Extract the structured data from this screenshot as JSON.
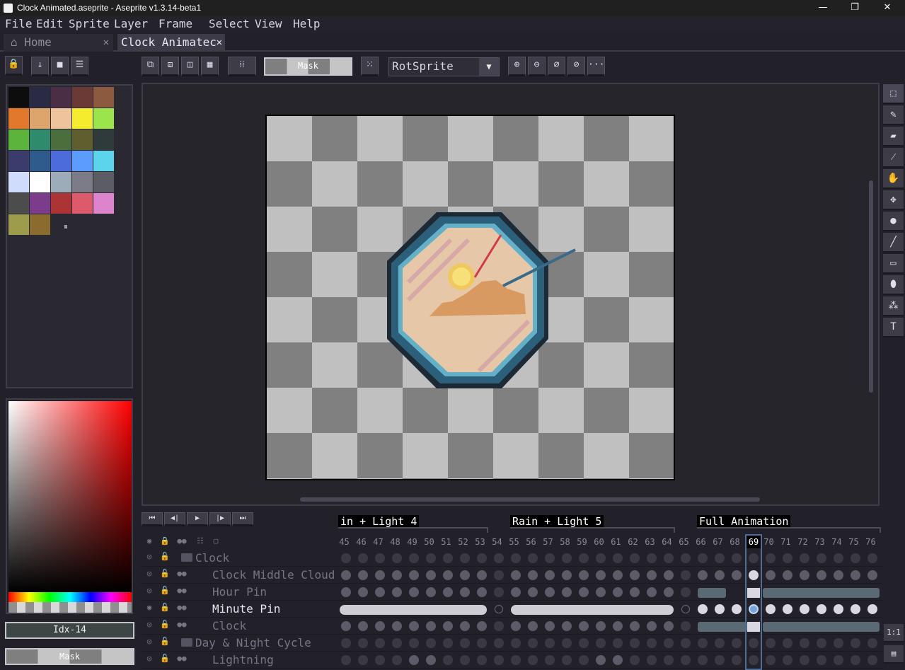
{
  "window": {
    "title": "Clock Animated.aseprite - Aseprite v1.3.14-beta1",
    "minimize": "—",
    "maximize": "❐",
    "close": "✕"
  },
  "menu": [
    {
      "label": "File"
    },
    {
      "label": "Edit"
    },
    {
      "label": "Sprite"
    },
    {
      "label": "Layer"
    },
    {
      "label": "Frame"
    },
    {
      "label": "Select"
    },
    {
      "label": "View"
    },
    {
      "label": "Help"
    }
  ],
  "tabs": {
    "home": "Home",
    "active": "Clock Animatec",
    "close": "✕"
  },
  "toolbar": {
    "mask_label": "Mask",
    "algorithm": "RotSprite",
    "more": "···"
  },
  "palette": {
    "more_glyph": "⏸",
    "colors": [
      "#0d0d0d",
      "#2a2a44",
      "#4a2e46",
      "#6b3a36",
      "#8c5a3e",
      "#e2782c",
      "#dda46c",
      "#efc49c",
      "#f4ec2c",
      "#9ce44c",
      "#5cb43c",
      "#2e8c6c",
      "#4a6e3c",
      "#5e5e2e",
      "#2f3a3a",
      "#3c3c6c",
      "#2e5a8c",
      "#4c6cdc",
      "#5c9cfc",
      "#5cd4ec",
      "#d0dcfc",
      "#ffffff",
      "#9cacb8",
      "#7c7c88",
      "#5c5c64",
      "#4c4c4c",
      "#7c3c8c",
      "#ac3434",
      "#dc5a6c",
      "#dc84cc",
      "#9c9c4c",
      "#8c6c2e"
    ]
  },
  "color_bar": {
    "index_label": "Idx-14",
    "mask_label": "Mask"
  },
  "timeline": {
    "tags": [
      "in + Light 4",
      "Rain + Light 5",
      "Full Animation"
    ],
    "frames": [
      "45",
      "46",
      "47",
      "48",
      "49",
      "50",
      "51",
      "52",
      "53",
      "54",
      "55",
      "56",
      "57",
      "58",
      "59",
      "60",
      "61",
      "62",
      "63",
      "64",
      "65",
      "66",
      "67",
      "68",
      "69",
      "70",
      "71",
      "72",
      "73",
      "74",
      "75",
      "76"
    ],
    "current_frame": "69",
    "layers": [
      {
        "name": "Clock"
      },
      {
        "name": "Clock Middle Cloud"
      },
      {
        "name": "Hour Pin"
      },
      {
        "name": "Minute Pin"
      },
      {
        "name": "Clock"
      },
      {
        "name": "Day & Night Cycle"
      },
      {
        "name": "Lightning"
      }
    ],
    "ratio_btn": "1:1"
  }
}
